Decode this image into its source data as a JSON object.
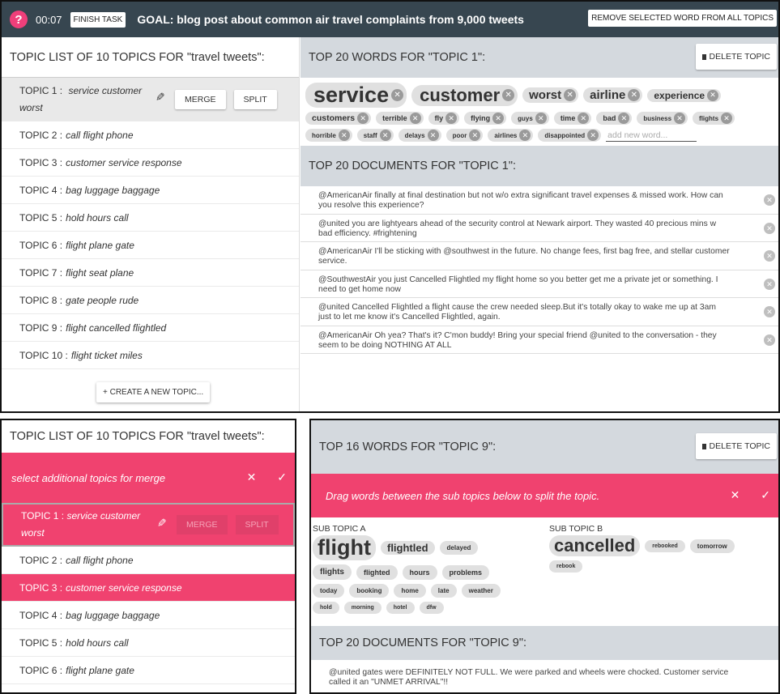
{
  "top": {
    "help_icon": "?",
    "timer": "00:07",
    "finish_task": "FINISH TASK",
    "goal": "GOAL: blog post about common air travel complaints from 9,000 tweets",
    "remove_word": "REMOVE SELECTED WORD FROM ALL TOPICS",
    "topic_list_title": "TOPIC LIST OF 10 TOPICS FOR \"travel tweets\":",
    "topics": [
      {
        "label": "TOPIC 1 :",
        "words": "service customer worst"
      },
      {
        "label": "TOPIC 2 :",
        "words": "call flight phone"
      },
      {
        "label": "TOPIC 3 :",
        "words": "customer service response"
      },
      {
        "label": "TOPIC 4 :",
        "words": "bag luggage baggage"
      },
      {
        "label": "TOPIC 5 :",
        "words": "hold hours call"
      },
      {
        "label": "TOPIC 6 :",
        "words": "flight plane gate"
      },
      {
        "label": "TOPIC 7 :",
        "words": "flight seat plane"
      },
      {
        "label": "TOPIC 8 :",
        "words": "gate people rude"
      },
      {
        "label": "TOPIC 9 :",
        "words": "flight cancelled flightled"
      },
      {
        "label": "TOPIC 10 :",
        "words": "flight ticket miles"
      }
    ],
    "merge": "MERGE",
    "split": "SPLIT",
    "create_topic": "+ CREATE A NEW TOPIC...",
    "words_title": "TOP 20 WORDS FOR \"TOPIC 1\":",
    "delete_topic": "DELETE TOPIC",
    "words_xl": [
      "service",
      "customer"
    ],
    "words_l": [
      "worst",
      "airline",
      "experience"
    ],
    "words_m": [
      "customers",
      "terrible",
      "fly",
      "flying",
      "guys",
      "time",
      "bad",
      "business",
      "flights"
    ],
    "words_s": [
      "horrible",
      "staff",
      "delays",
      "poor",
      "airlines",
      "disappointed"
    ],
    "add_word_placeholder": "add new word...",
    "docs_title": "TOP 20 DOCUMENTS FOR \"TOPIC 1\":",
    "docs": [
      "@AmericanAir finally at final destination but not w/o extra significant travel expenses & missed work. How can you resolve this experience?",
      "@united you are lightyears ahead of the security control at Newark airport. They wasted 40 precious mins w bad efficiency. #frightening",
      "@AmericanAir I'll be sticking with @southwest in the future. No change fees, first bag free, and stellar customer service.",
      "@SouthwestAir you just Cancelled Flightled my flight home so you better get me a private jet or something. I need to get home now",
      "@united Cancelled Flightled a flight cause the crew needed sleep.But it's totally okay to wake me up at 3am just to let me know it's Cancelled Flightled, again.",
      "@AmericanAir Oh yea? That's it? C'mon buddy! Bring your special friend @united to the conversation - they seem to be doing NOTHING AT ALL"
    ]
  },
  "bottom_left": {
    "title": "TOPIC LIST OF 10 TOPICS FOR \"travel tweets\":",
    "merge_prompt": "select additional topics for merge",
    "close_icon": "✕",
    "check_icon": "✓",
    "selected": {
      "label": "TOPIC 1 :",
      "words": "service customer worst"
    },
    "merge": "MERGE",
    "split": "SPLIT",
    "items": [
      {
        "label": "TOPIC 2 :",
        "words": "call flight phone"
      },
      {
        "label": "TOPIC 3 :",
        "words": "customer service response"
      },
      {
        "label": "TOPIC 4 :",
        "words": "bag luggage baggage"
      },
      {
        "label": "TOPIC 5 :",
        "words": "hold hours call"
      },
      {
        "label": "TOPIC 6 :",
        "words": "flight plane gate"
      }
    ]
  },
  "bottom_right": {
    "words_title": "TOP 16 WORDS FOR \"TOPIC 9\":",
    "delete_topic": "DELETE TOPIC",
    "split_prompt": "Drag words between the sub topics below to split the topic.",
    "close_icon": "✕",
    "check_icon": "✓",
    "sub_a_label": "SUB TOPIC A",
    "sub_a_words": {
      "huge": "flight",
      "big": [
        "flightled"
      ],
      "sm_row1": [
        "delayed"
      ],
      "row2": [
        "flights",
        "flighted",
        "hours",
        "problems"
      ],
      "row3": [
        "today",
        "booking",
        "home",
        "late",
        "weather"
      ],
      "row4": [
        "hold",
        "morning",
        "hotel",
        "dfw"
      ]
    },
    "sub_b_label": "SUB TOPIC B",
    "sub_b_words": {
      "huge": "cancelled",
      "sm_row1": [
        "rebooked",
        "tomorrow"
      ],
      "row2": [
        "rebook"
      ]
    },
    "docs_title": "TOP 20 DOCUMENTS FOR \"TOPIC 9\":",
    "doc": "@united gates were DEFINITELY NOT FULL. We were parked and wheels were chocked. Customer service called it an \"UNMET ARRIVAL\"!!"
  }
}
